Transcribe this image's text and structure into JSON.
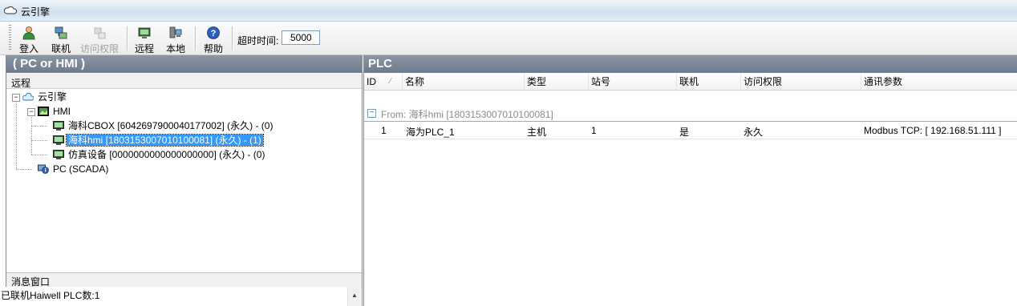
{
  "window": {
    "title": "云引擎"
  },
  "toolbar": {
    "login": "登入",
    "connect": "联机",
    "access_rights": "访问权限",
    "remote": "远程",
    "local": "本地",
    "help": "帮助",
    "timeout_label": "超时时间:",
    "timeout_value": "5000"
  },
  "left_panel": {
    "header": "( PC or HMI )",
    "subheader": "远程",
    "tree": {
      "root": "云引擎",
      "hmi": "HMI",
      "children": [
        "海科CBOX [6042697900040177002] (永久) - (0)",
        "海科hmi [1803153007010100081] (永久) - (1)",
        "仿真设备 [0000000000000000000] (永久) - (0)"
      ],
      "pc": "PC (SCADA)"
    },
    "message_header": "消息窗口",
    "message": "已联机Haiwell PLC数:1"
  },
  "right_panel": {
    "header": "PLC",
    "columns": [
      "ID",
      "名称",
      "类型",
      "站号",
      "联机",
      "访问权限",
      "通讯参数"
    ],
    "group_label": "From: 海科hmi [1803153007010100081]",
    "rows": [
      {
        "id": "1",
        "name": "海为PLC_1",
        "type": "主机",
        "station": "1",
        "online": "是",
        "access": "永久",
        "comm": "Modbus TCP: [ 192.168.51.111 ]"
      }
    ]
  }
}
